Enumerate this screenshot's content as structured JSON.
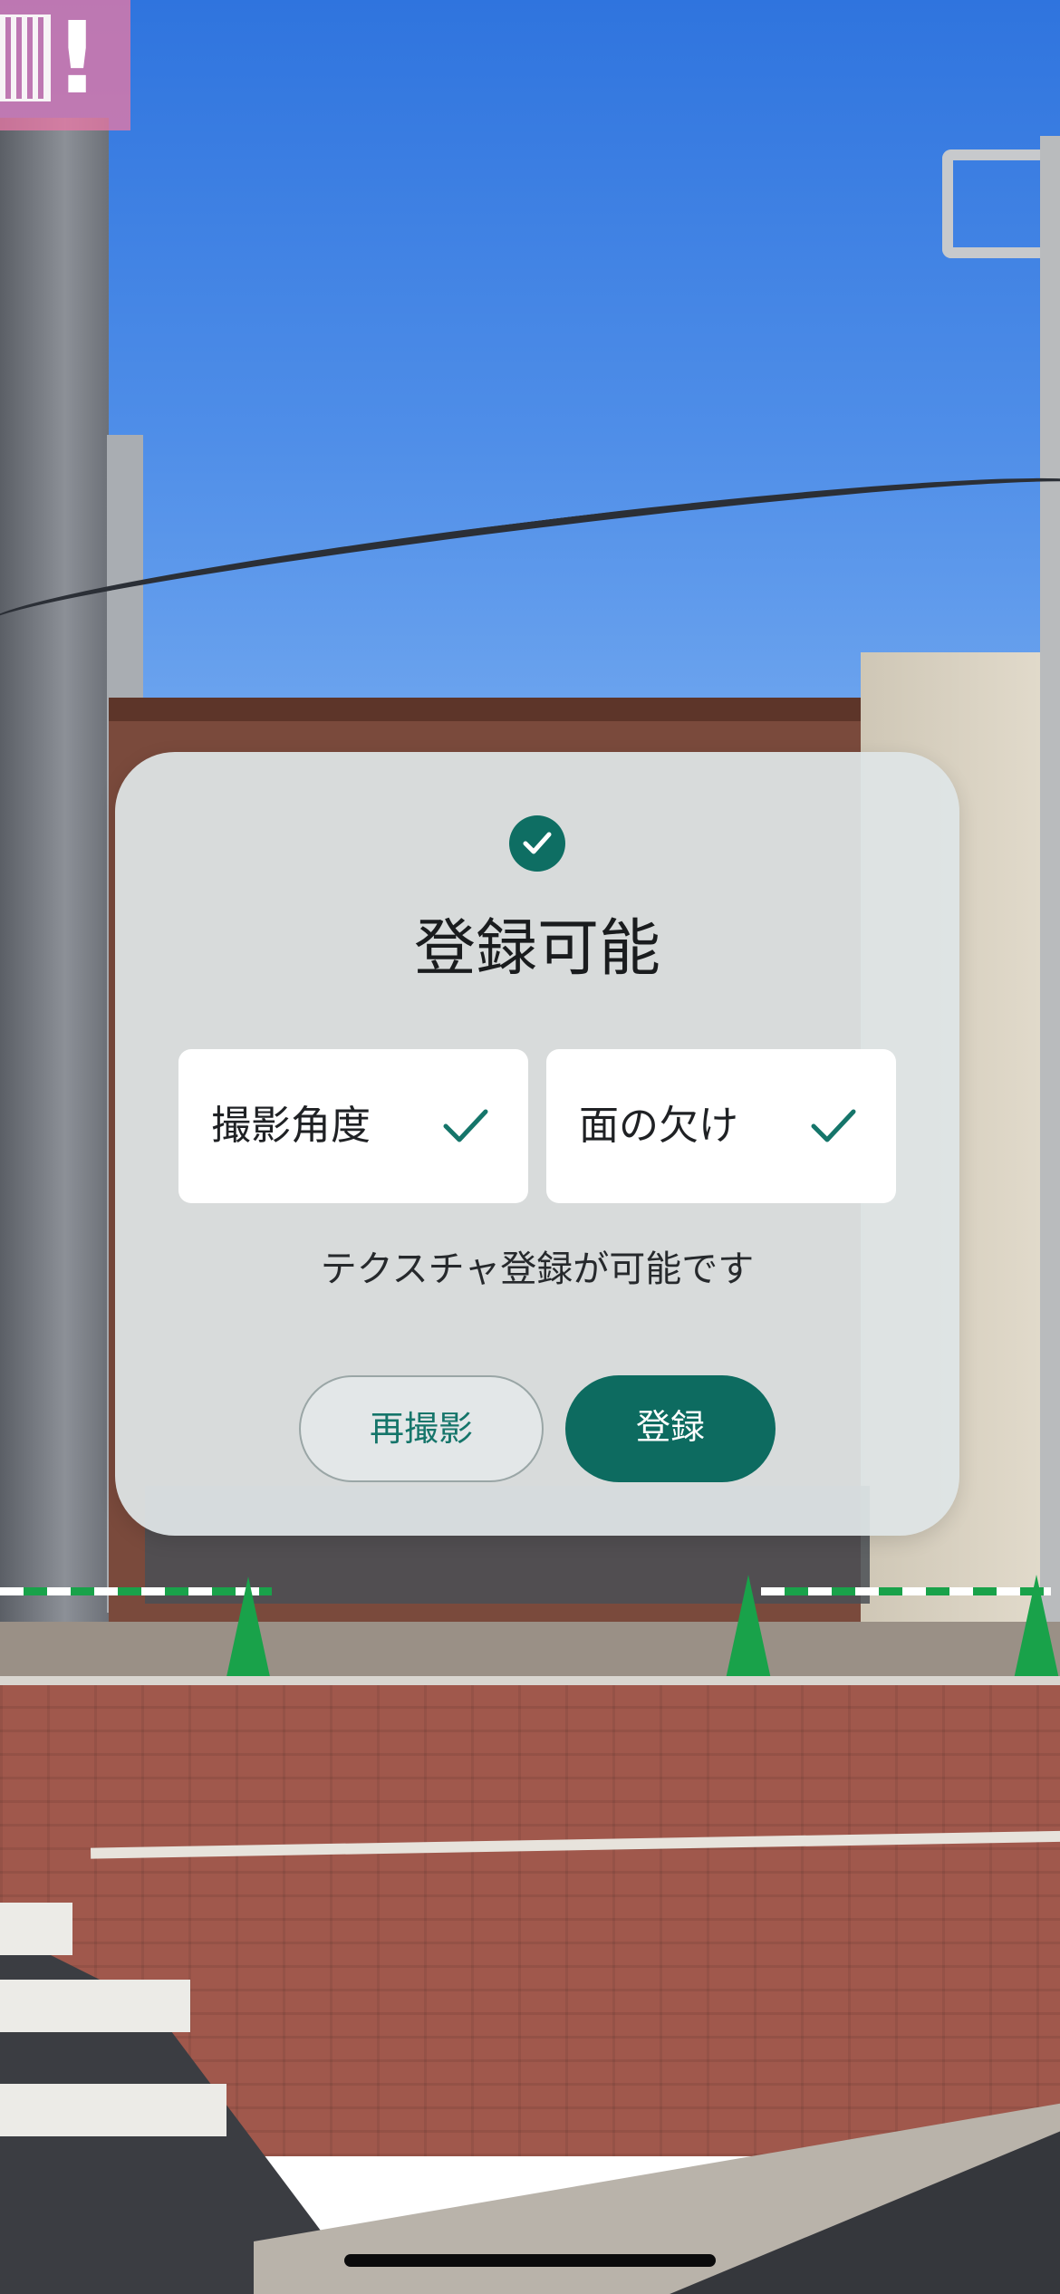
{
  "status": {
    "icon": "check-circle-icon",
    "title": "登録可能"
  },
  "checks": [
    {
      "label": "撮影角度",
      "icon": "check-icon",
      "passed": true
    },
    {
      "label": "面の欠け",
      "icon": "check-icon",
      "passed": true
    }
  ],
  "message": "テクスチャ登録が可能です",
  "buttons": {
    "retake_label": "再撮影",
    "register_label": "登録"
  },
  "recording_indicator": {
    "icon": "screen-recording-icon",
    "symbol": "!"
  },
  "colors": {
    "accent": "#0d6b60",
    "accent_text": "#15756a",
    "card_background": "#dee4e6",
    "recording_badge": "#e678a5"
  }
}
